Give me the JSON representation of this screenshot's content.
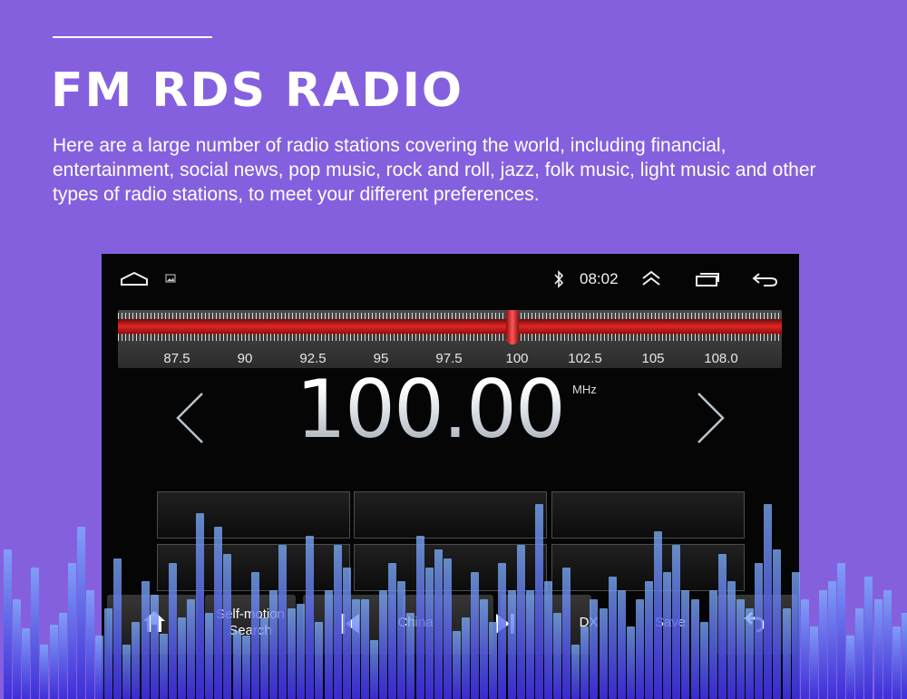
{
  "header": {
    "title": "FM RDS RADIO",
    "description": "Here are a large number of radio stations covering the world, including financial, entertainment, social news, pop music, rock and roll, jazz, folk music, light music and other types of radio stations, to meet your different preferences."
  },
  "statusbar": {
    "time": "08:02",
    "icons": [
      "home-outline-icon",
      "image-icon",
      "bluetooth-icon",
      "chevron-up-double-icon",
      "recent-apps-icon",
      "back-arrow-icon"
    ]
  },
  "tuner": {
    "scale": [
      "87.5",
      "90",
      "92.5",
      "95",
      "97.5",
      "100",
      "102.5",
      "105",
      "108.0"
    ],
    "frequency": "100.00",
    "unit": "MHz"
  },
  "presets": [
    "",
    "",
    "",
    "",
    "",
    ""
  ],
  "controls": {
    "home_icon": "home-icon",
    "self_motion_search": "Self-motion Search",
    "prev_icon": "skip-previous-icon",
    "region": "China",
    "next_icon": "skip-next-icon",
    "dx": "DX",
    "save": "Save",
    "back_icon": "return-icon"
  },
  "colors": {
    "background": "#8560DE",
    "screen": "#050505",
    "tuner_band": "#E02626",
    "eq_bar_top": "#7FB2FF",
    "eq_bar_bottom": "#3C2CD8"
  }
}
